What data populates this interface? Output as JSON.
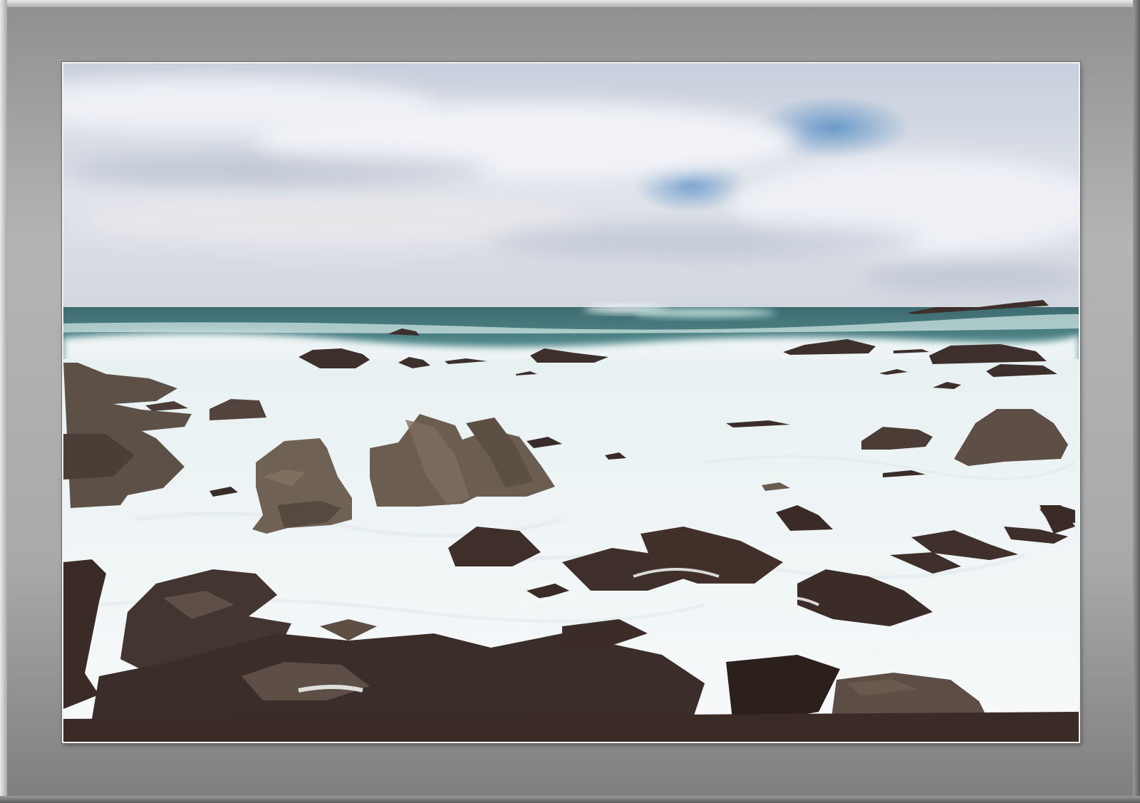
{
  "scene": {
    "subject": "rocky-seashore-with-breaking-waves",
    "colors": {
      "sky_top": "#c9d0dc",
      "sky_blue": "#6f9cc9",
      "cloud": "#eef0f4",
      "horizon_haze": "#d5dae3",
      "sea_deep": "#3f6f74",
      "sea_teal": "#4f8f92",
      "foam": "#f4f7f8",
      "rock_light": "#6f6154",
      "rock_dark": "#3a2b26",
      "rock_seaweed": "#2d1f1c",
      "mat": "#a9a9a9"
    }
  }
}
